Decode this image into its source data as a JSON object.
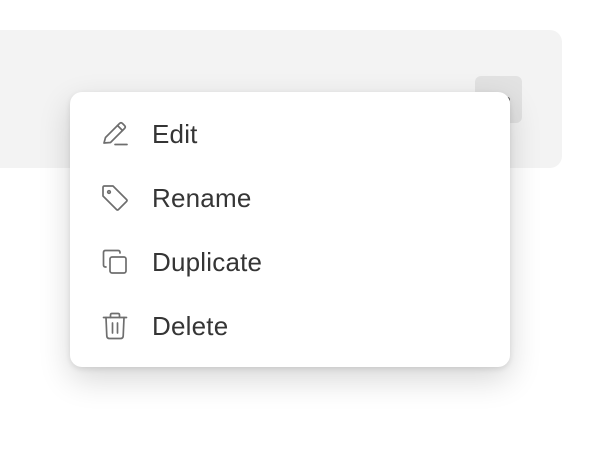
{
  "menu": {
    "items": [
      {
        "label": "Edit",
        "icon": "pencil-icon"
      },
      {
        "label": "Rename",
        "icon": "tag-icon"
      },
      {
        "label": "Duplicate",
        "icon": "copy-icon"
      },
      {
        "label": "Delete",
        "icon": "trash-icon"
      }
    ]
  },
  "colors": {
    "card_background": "#f3f3f3",
    "menu_background": "#ffffff",
    "icon_stroke": "#6e6e6e",
    "label_text": "#353535"
  }
}
